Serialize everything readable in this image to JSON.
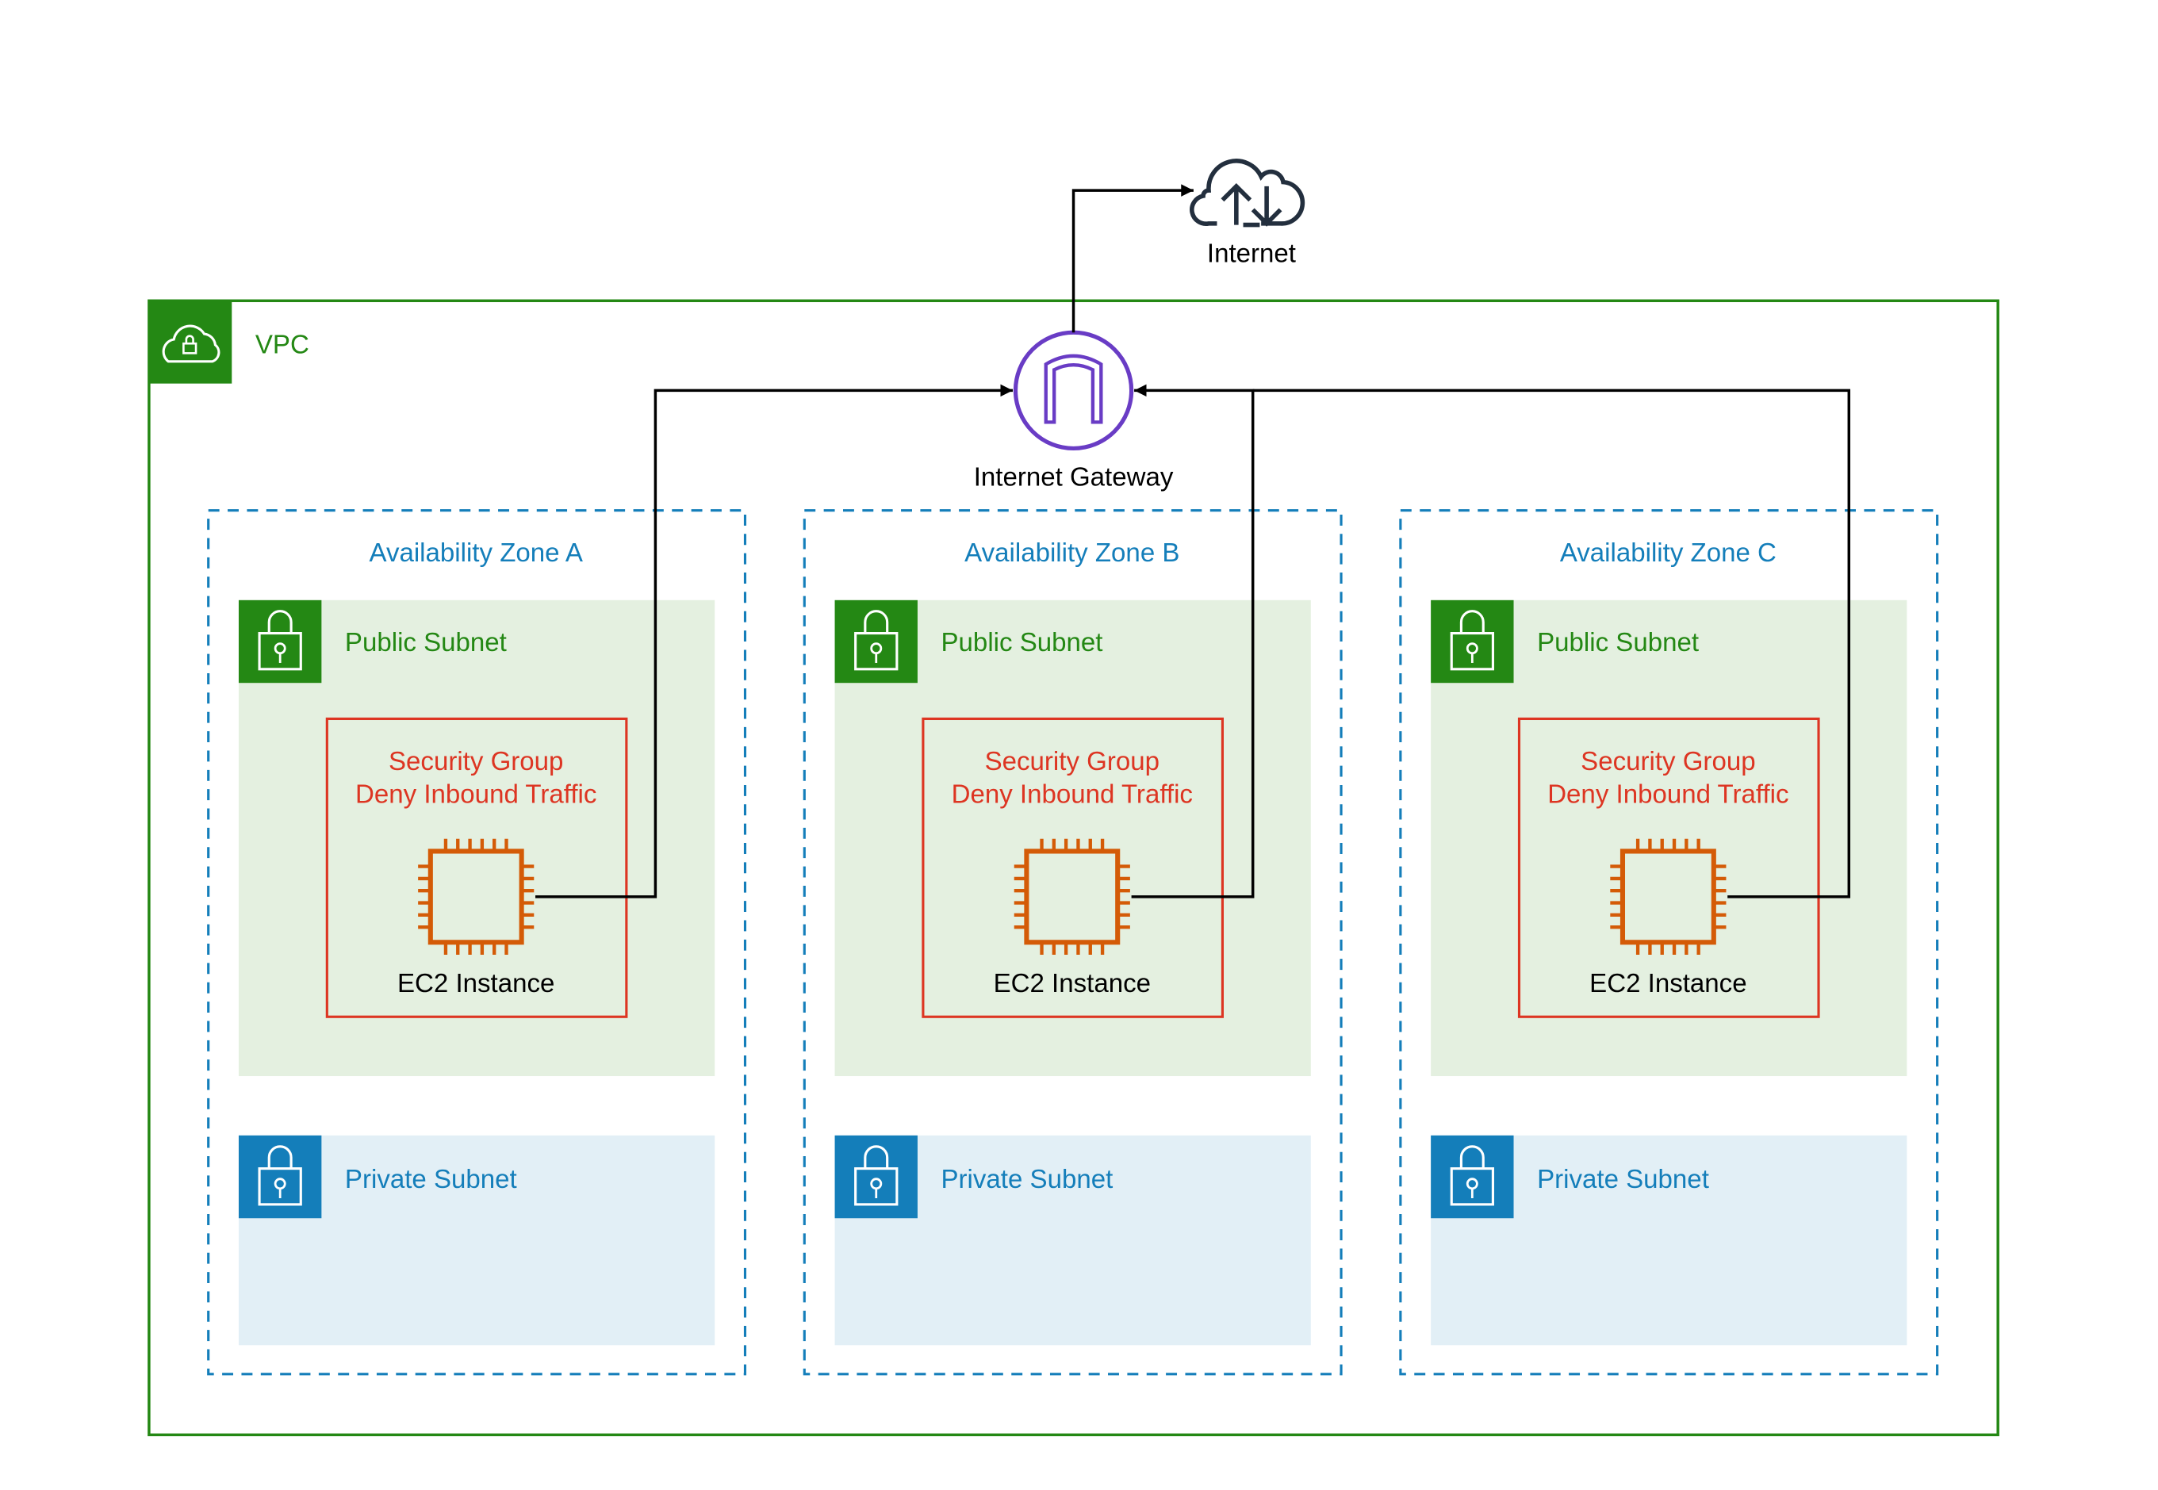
{
  "colors": {
    "vpc": "#248814",
    "public_fill": "#E4F0E0",
    "private_fill": "#E2EFF6",
    "az": "#147EBA",
    "security_group": "#DD3522",
    "ec2": "#D45B07",
    "gateway": "#693CC5",
    "internet": "#232F3E",
    "connector": "#000000"
  },
  "internet": {
    "label": "Internet",
    "icon": "cloud-upload-download-icon"
  },
  "vpc": {
    "label": "VPC",
    "icon": "cloud-lock-icon"
  },
  "gateway": {
    "label": "Internet Gateway",
    "icon": "internet-gateway-icon"
  },
  "zones": [
    {
      "label": "Availability Zone A",
      "public_subnet": "Public Subnet",
      "sg_line1": "Security Group",
      "sg_line2": "Deny Inbound Traffic",
      "ec2": "EC2 Instance",
      "private_subnet": "Private Subnet"
    },
    {
      "label": "Availability Zone B",
      "public_subnet": "Public Subnet",
      "sg_line1": "Security Group",
      "sg_line2": "Deny Inbound Traffic",
      "ec2": "EC2 Instance",
      "private_subnet": "Private Subnet"
    },
    {
      "label": "Availability Zone C",
      "public_subnet": "Public Subnet",
      "sg_line1": "Security Group",
      "sg_line2": "Deny Inbound Traffic",
      "ec2": "EC2 Instance",
      "private_subnet": "Private Subnet"
    }
  ]
}
